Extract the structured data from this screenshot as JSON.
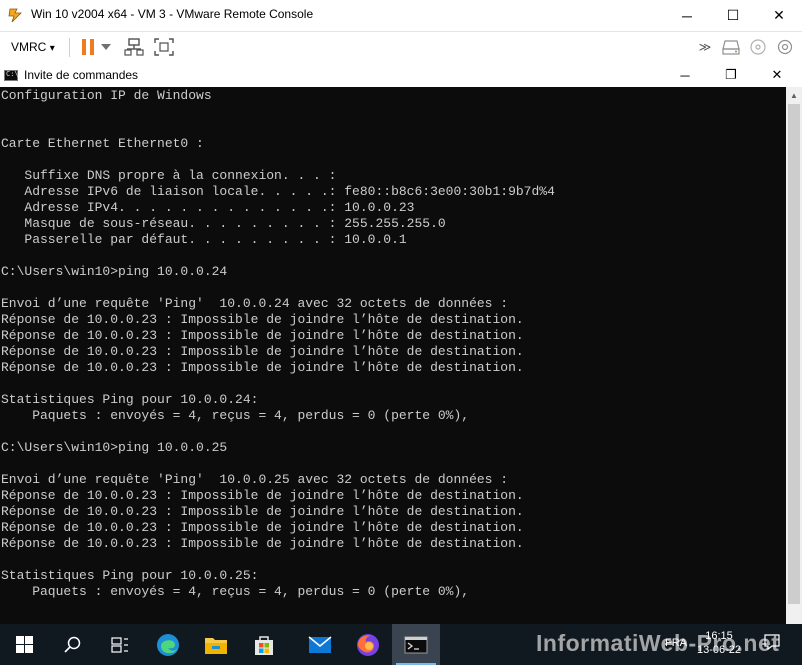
{
  "vmrc": {
    "title": "Win 10 v2004 x64 - VM 3 - VMware Remote Console",
    "menu_label": "VMRC",
    "menu_arrow": "▾",
    "minimize": "─",
    "maximize": "☐",
    "close": "✕"
  },
  "cmd": {
    "title": "Invite de commandes",
    "icon_text": "C:\\",
    "minimize": "─",
    "maximize": "❐",
    "close": "✕",
    "lines": [
      "Configuration IP de Windows",
      "",
      "",
      "Carte Ethernet Ethernet0 :",
      "",
      "   Suffixe DNS propre à la connexion. . . :",
      "   Adresse IPv6 de liaison locale. . . . .: fe80::b8c6:3e00:30b1:9b7d%4",
      "   Adresse IPv4. . . . . . . . . . . . . .: 10.0.0.23",
      "   Masque de sous-réseau. . . . . . . . . : 255.255.255.0",
      "   Passerelle par défaut. . . . . . . . . : 10.0.0.1",
      "",
      "C:\\Users\\win10>ping 10.0.0.24",
      "",
      "Envoi d’une requête 'Ping'  10.0.0.24 avec 32 octets de données :",
      "Réponse de 10.0.0.23 : Impossible de joindre l’hôte de destination.",
      "Réponse de 10.0.0.23 : Impossible de joindre l’hôte de destination.",
      "Réponse de 10.0.0.23 : Impossible de joindre l’hôte de destination.",
      "Réponse de 10.0.0.23 : Impossible de joindre l’hôte de destination.",
      "",
      "Statistiques Ping pour 10.0.0.24:",
      "    Paquets : envoyés = 4, reçus = 4, perdus = 0 (perte 0%),",
      "",
      "C:\\Users\\win10>ping 10.0.0.25",
      "",
      "Envoi d’une requête 'Ping'  10.0.0.25 avec 32 octets de données :",
      "Réponse de 10.0.0.23 : Impossible de joindre l’hôte de destination.",
      "Réponse de 10.0.0.23 : Impossible de joindre l’hôte de destination.",
      "Réponse de 10.0.0.23 : Impossible de joindre l’hôte de destination.",
      "Réponse de 10.0.0.23 : Impossible de joindre l’hôte de destination.",
      "",
      "Statistiques Ping pour 10.0.0.25:",
      "    Paquets : envoyés = 4, reçus = 4, perdus = 0 (perte 0%),"
    ]
  },
  "taskbar": {
    "apps": [
      "start-icon",
      "search-icon",
      "task-view-icon",
      "edge-icon",
      "file-explorer-icon",
      "store-icon",
      "mail-icon",
      "firefox-icon",
      "cmd-icon"
    ],
    "tray_lang": "FRA",
    "time": "16:15",
    "date": "13-06-22"
  },
  "watermark": "InformatiWeb-Pro.net",
  "colors": {
    "console_bg": "#0c0c0c",
    "console_text": "#cccccc",
    "pause_orange": "#f07c22",
    "taskbar_bg": "#101820",
    "vmware_orange": "#f5a623"
  }
}
